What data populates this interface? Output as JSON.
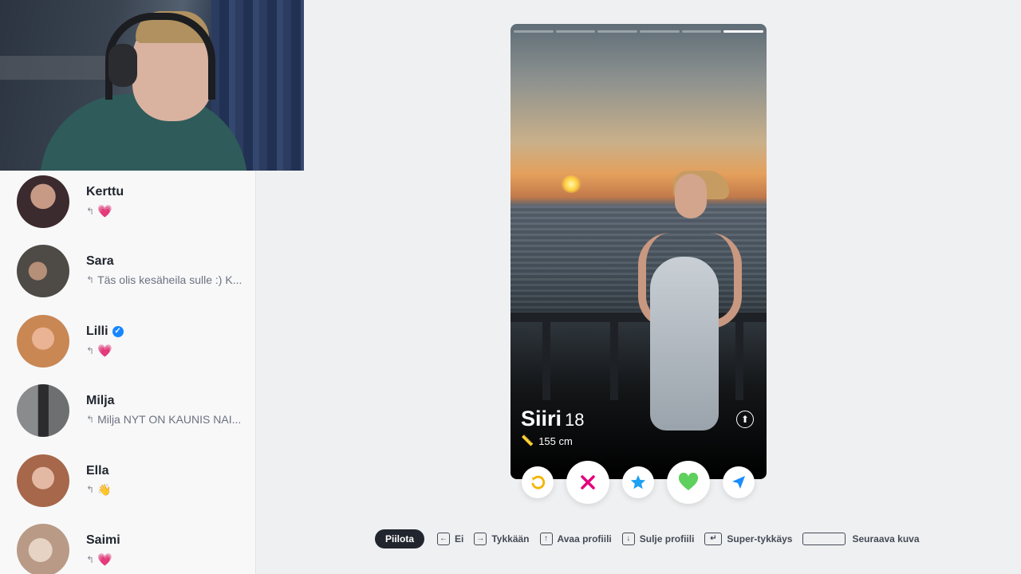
{
  "messages": [
    {
      "name": "Kerttu",
      "preview": "💗",
      "verified": false,
      "avatar_color": "#3b2a2e"
    },
    {
      "name": "Sara",
      "preview": "Täs olis kesäheila sulle :) K...",
      "verified": false,
      "avatar_color": "#4e4a45"
    },
    {
      "name": "Lilli",
      "preview": "💗",
      "verified": true,
      "avatar_color": "#c98754"
    },
    {
      "name": "Milja",
      "preview": "Milja NYT ON KAUNIS NAI...",
      "verified": false,
      "avatar_color": "#575859"
    },
    {
      "name": "Ella",
      "preview": "👋",
      "verified": false,
      "avatar_color": "#a6674a"
    },
    {
      "name": "Saimi",
      "preview": "💗",
      "verified": false,
      "avatar_color": "#b89a86"
    }
  ],
  "profile": {
    "name": "Siiri",
    "age": "18",
    "height": "155 cm",
    "photo_count": 6,
    "active_photo": 6
  },
  "actions": {
    "rewind": "rewind-icon",
    "nope": "x-icon",
    "super_like": "star-icon",
    "like": "heart-icon",
    "boost": "send-icon"
  },
  "hints": {
    "hide": "Piilota",
    "nope_key": "←",
    "nope": "Ei",
    "like_key": "→",
    "like": "Tykkään",
    "open_key": "↑",
    "open": "Avaa profiili",
    "close_key": "↓",
    "close": "Sulje profiili",
    "super_key": "↵",
    "super": "Super-tykkäys",
    "next": "Seuraava kuva"
  },
  "colors": {
    "nope": "#e3007b",
    "super": "#1da1f2",
    "like": "#5ed05d",
    "rewind": "#f5b301",
    "boost": "#1a8cff"
  }
}
